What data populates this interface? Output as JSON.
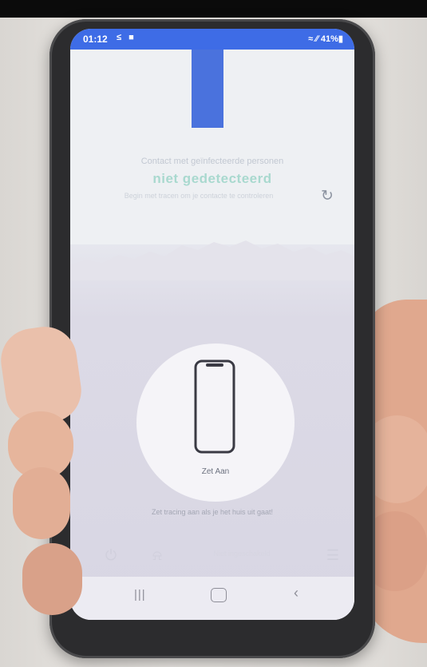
{
  "status_bar": {
    "time": "01:12",
    "left_icons": "≤ ■",
    "right": "≈ ∕∕ 41%▮"
  },
  "contact": {
    "title": "Contact met geïnfecteerde personen",
    "state": "niet gedetecteerd",
    "hint": "Begin met tracen om je contacte te controleren"
  },
  "toggle": {
    "label": "Zet Aan",
    "hint": "Zet tracing aan als je het huis uit gaat!"
  },
  "tabbar": {
    "status_text": "Niet ingeschakeld"
  },
  "colors": {
    "accent": "#3e6ce6",
    "state_text": "#a9d9cf"
  },
  "icons": [
    "refresh-icon",
    "phone-icon",
    "power-icon",
    "bell-icon",
    "menu-icon",
    "recent-apps-icon",
    "home-icon",
    "back-icon"
  ]
}
